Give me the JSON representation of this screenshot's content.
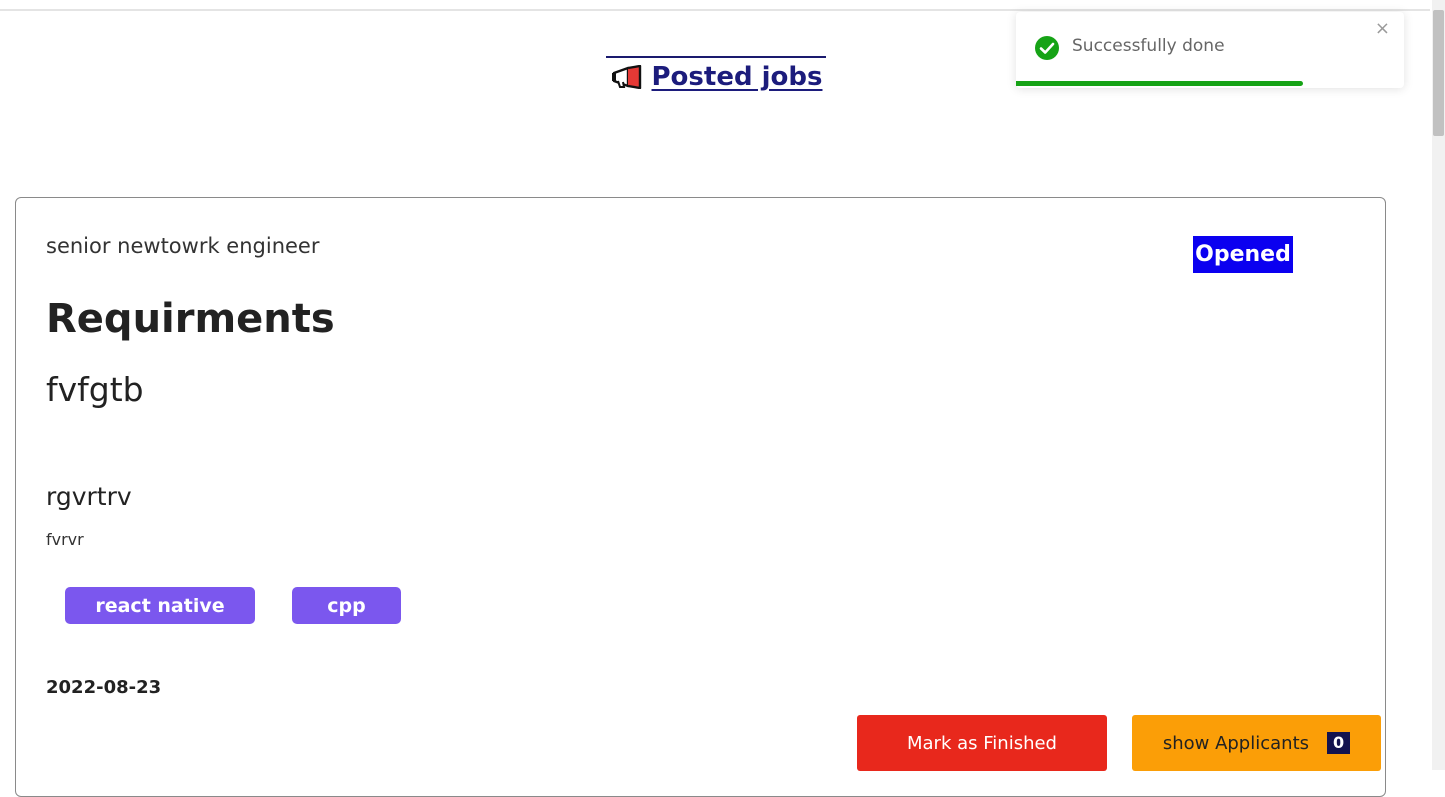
{
  "header": {
    "title": "Posted jobs",
    "icon": "megaphone-icon"
  },
  "toast": {
    "message": "Successfully done",
    "icon": "check-circle-icon",
    "close_label": "×",
    "progress": 0.74,
    "colors": {
      "success": "#16a316"
    }
  },
  "job": {
    "title": "senior newtowrk engineer",
    "status": "Opened",
    "requirements_heading": "Requirments",
    "requirements_text": "fvfgtb",
    "subtitle": "rgvrtrv",
    "description": "fvrvr",
    "tags": [
      "react native",
      "cpp"
    ],
    "date": "2022-08-23"
  },
  "actions": {
    "finish_label": "Mark as Finished",
    "applicants_label": "show Applicants",
    "applicants_count": "0"
  },
  "colors": {
    "heading": "#1c1c7c",
    "status_badge": "#0b00f0",
    "tag": "#7b57ee",
    "finish_button": "#e8281c",
    "applicants_button": "#fb9e07"
  }
}
